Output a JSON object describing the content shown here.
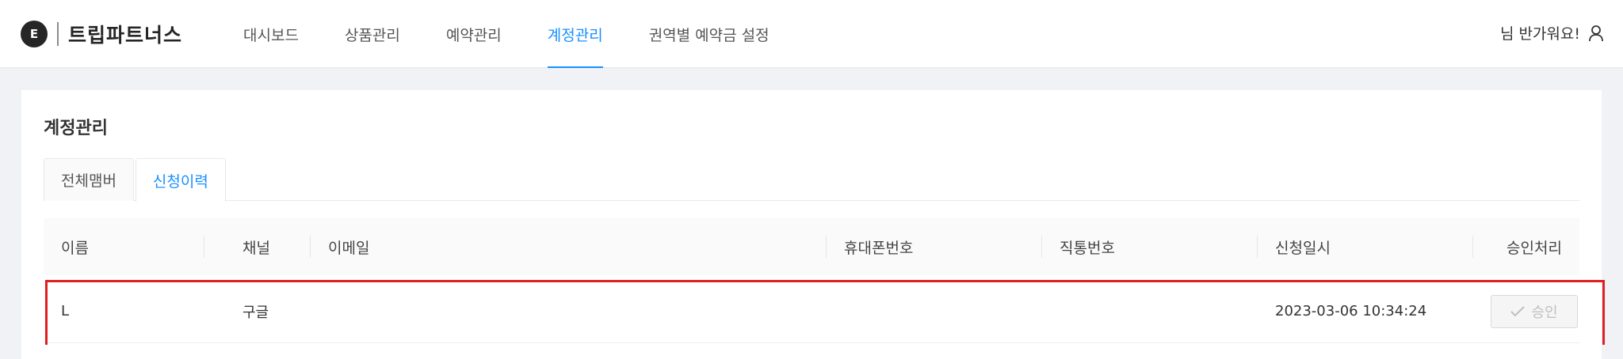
{
  "header": {
    "logo_mark": "E",
    "logo_text": "트립파트너스",
    "nav": [
      {
        "label": "대시보드",
        "active": false
      },
      {
        "label": "상품관리",
        "active": false
      },
      {
        "label": "예약관리",
        "active": false
      },
      {
        "label": "계정관리",
        "active": true
      },
      {
        "label": "권역별 예약금 설정",
        "active": false
      }
    ],
    "greeting": "님 반가워요!",
    "user_icon": "user-icon"
  },
  "page": {
    "title": "계정관리",
    "tabs": [
      {
        "label": "전체맴버",
        "active": false
      },
      {
        "label": "신청이력",
        "active": true
      }
    ]
  },
  "table": {
    "columns": [
      "이름",
      "채널",
      "이메일",
      "휴대폰번호",
      "직통번호",
      "신청일시",
      "승인처리"
    ],
    "rows": [
      {
        "name": "L",
        "channel": "구글",
        "email": "",
        "mobile": "",
        "direct": "",
        "requested_at": "2023-03-06 10:34:24",
        "action_label": "승인",
        "action_icon": "check-icon",
        "highlighted": true
      }
    ]
  },
  "colors": {
    "accent": "#1890ff",
    "highlight_border": "#e02020",
    "background": "#f0f2f5"
  }
}
